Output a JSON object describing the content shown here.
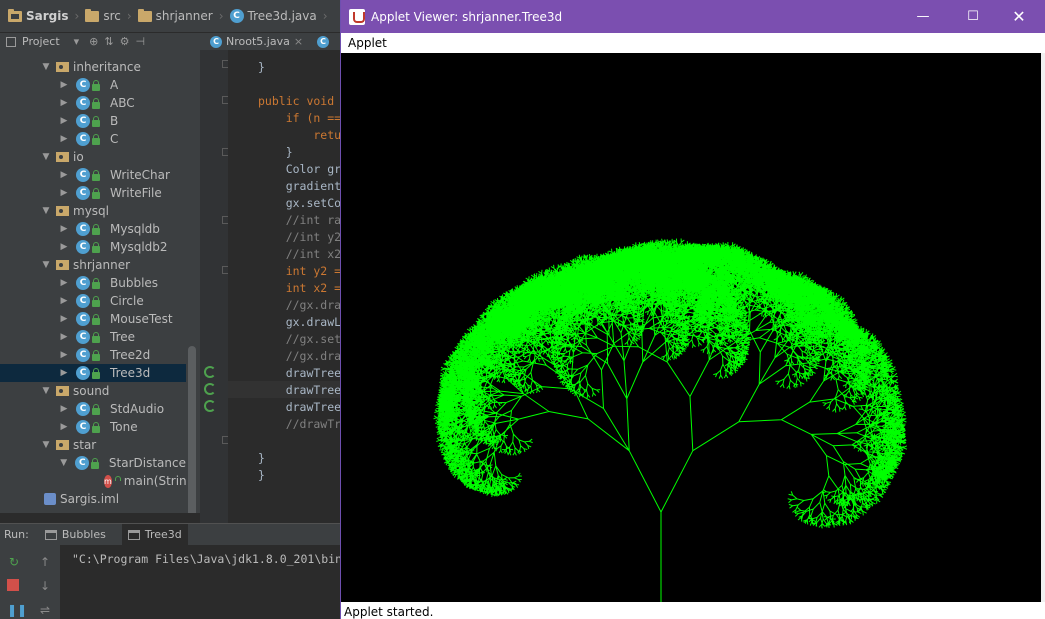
{
  "breadcrumb": {
    "project": "Sargis",
    "src": "src",
    "package": "shrjanner",
    "file": "Tree3d.java"
  },
  "project_toolbar": {
    "label": "Project"
  },
  "editor_tabs": [
    {
      "label": "Nroot5.java"
    }
  ],
  "tree": {
    "rows": [
      {
        "kind": "package",
        "label": "inheritance",
        "expanded": true
      },
      {
        "kind": "class",
        "label": "A"
      },
      {
        "kind": "class",
        "label": "ABC"
      },
      {
        "kind": "class",
        "label": "B"
      },
      {
        "kind": "class",
        "label": "C"
      },
      {
        "kind": "package",
        "label": "io",
        "expanded": true
      },
      {
        "kind": "class",
        "label": "WriteChar"
      },
      {
        "kind": "class",
        "label": "WriteFile"
      },
      {
        "kind": "package",
        "label": "mysql",
        "expanded": true
      },
      {
        "kind": "class",
        "label": "Mysqldb"
      },
      {
        "kind": "class",
        "label": "Mysqldb2"
      },
      {
        "kind": "package",
        "label": "shrjanner",
        "expanded": true
      },
      {
        "kind": "class",
        "label": "Bubbles"
      },
      {
        "kind": "class",
        "label": "Circle"
      },
      {
        "kind": "class",
        "label": "MouseTest"
      },
      {
        "kind": "class",
        "label": "Tree"
      },
      {
        "kind": "class",
        "label": "Tree2d"
      },
      {
        "kind": "class",
        "label": "Tree3d",
        "selected": true
      },
      {
        "kind": "package",
        "label": "sound",
        "expanded": true
      },
      {
        "kind": "class",
        "label": "StdAudio"
      },
      {
        "kind": "class",
        "label": "Tone"
      },
      {
        "kind": "package",
        "label": "star",
        "expanded": true
      },
      {
        "kind": "class",
        "label": "StarDistance",
        "expanded": true
      },
      {
        "kind": "method",
        "label": "main(Strin"
      },
      {
        "kind": "iml",
        "label": "Sargis.iml"
      }
    ]
  },
  "code": {
    "lines": [
      {
        "text": "}"
      },
      {
        "text": ""
      },
      {
        "text": "public void "
      },
      {
        "text": "    if (n =="
      },
      {
        "text": "        retu"
      },
      {
        "text": "    }"
      },
      {
        "text": "    Color gr"
      },
      {
        "text": "    gradient"
      },
      {
        "text": "    gx.setCo"
      },
      {
        "text": "    //int ra"
      },
      {
        "text": "    //int y2"
      },
      {
        "text": "    //int x2"
      },
      {
        "text": "    int y2 ="
      },
      {
        "text": "    int x2 ="
      },
      {
        "text": "    //gx.dra"
      },
      {
        "text": "    gx.drawL"
      },
      {
        "text": "    //gx.set"
      },
      {
        "text": "    //gx.dra"
      },
      {
        "text": "    drawTree"
      },
      {
        "text": "    drawTree"
      },
      {
        "text": "    drawTree"
      },
      {
        "text": "    //drawTr"
      },
      {
        "text": ""
      },
      {
        "text": "}"
      },
      {
        "text": "}"
      }
    ]
  },
  "run_panel": {
    "label": "Run:",
    "tabs": [
      "Bubbles",
      "Tree3d"
    ],
    "console_line": "\"C:\\Program Files\\Java\\jdk1.8.0_201\\bin"
  },
  "applet": {
    "title": "Applet Viewer: shrjanner.Tree3d",
    "menu": "Applet",
    "status": "Applet started.",
    "tree_color": "#00ff00",
    "background": "#000000",
    "title_bar_color": "#7b4fb0",
    "window_buttons": [
      "minimize-icon",
      "maximize-icon",
      "close-icon"
    ]
  }
}
